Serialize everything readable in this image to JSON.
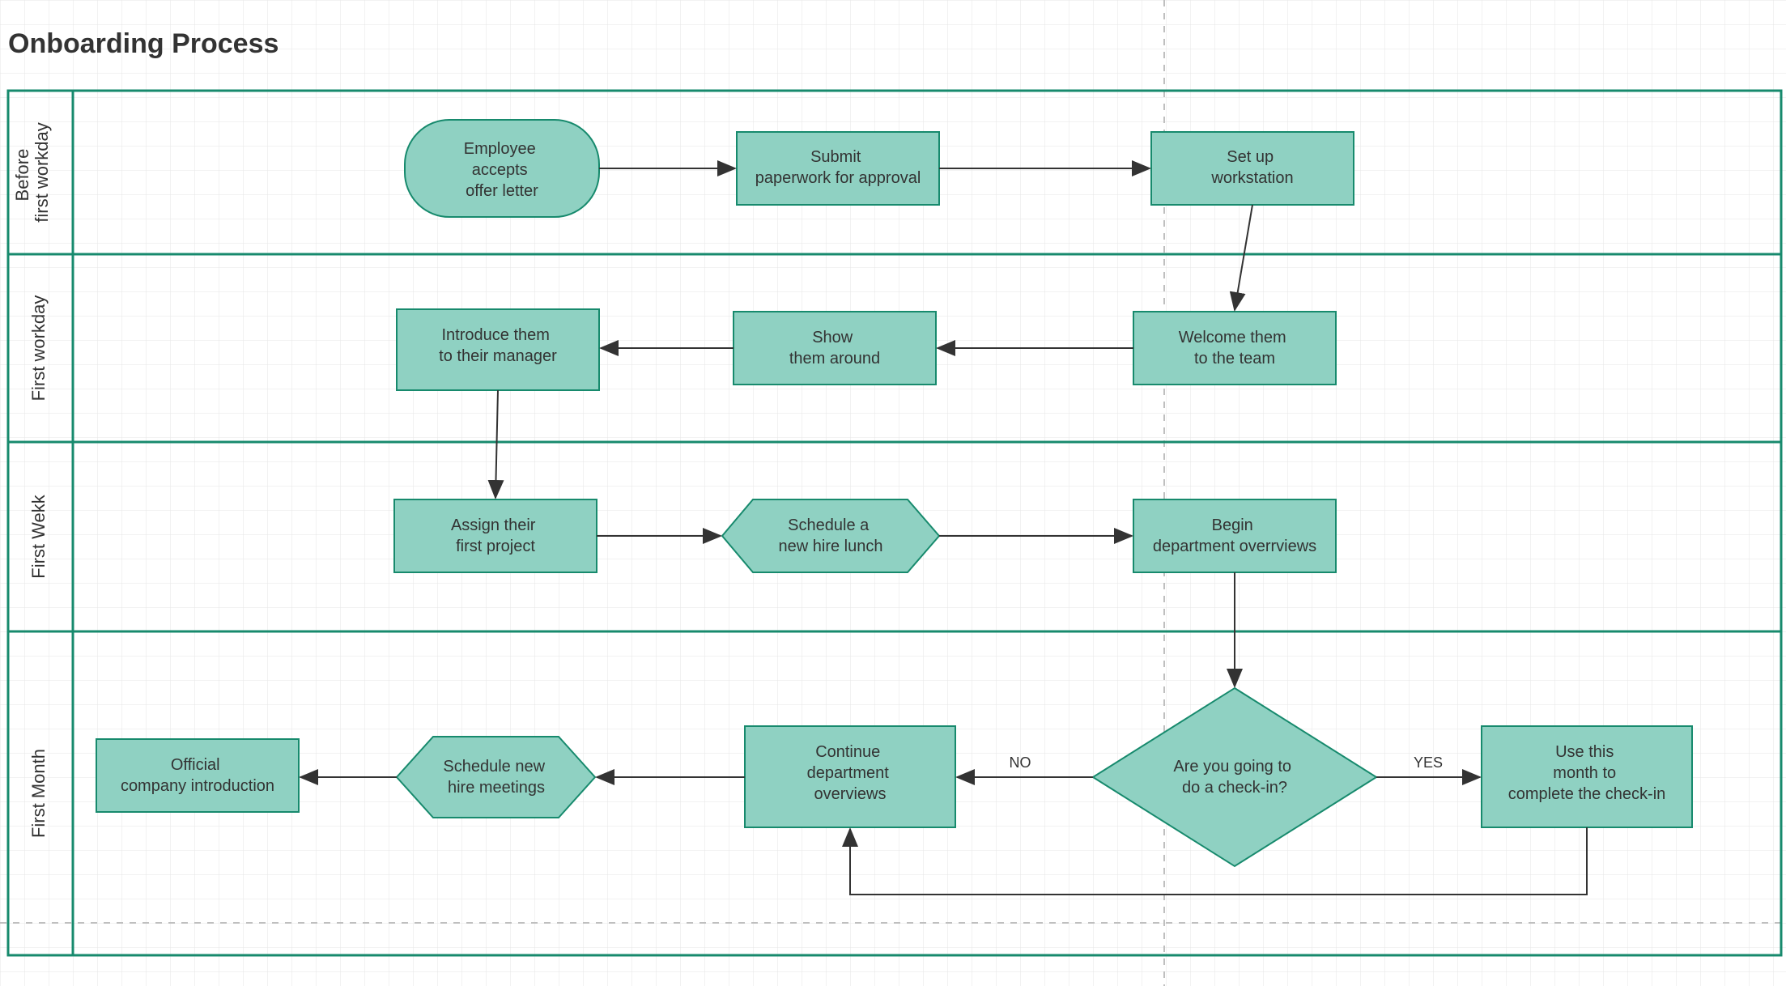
{
  "title": "Onboarding Process",
  "colors": {
    "shapeFill": "#8fd1c2",
    "shapeStroke": "#178a6d",
    "arrow": "#333333"
  },
  "lanes": [
    {
      "id": "lane0",
      "label": "Before first workday"
    },
    {
      "id": "lane1",
      "label": "First workday"
    },
    {
      "id": "lane2",
      "label": "First Wekk"
    },
    {
      "id": "lane3",
      "label": "First Month"
    }
  ],
  "nodes": {
    "n1": {
      "text": "Employee accepts offer letter",
      "shape": "terminator"
    },
    "n2": {
      "text": "Submit paperwork for approval",
      "shape": "process"
    },
    "n3": {
      "text": "Set up workstation",
      "shape": "process"
    },
    "n4": {
      "text": "Welcome them to the team",
      "shape": "process"
    },
    "n5": {
      "text": "Show them around",
      "shape": "process"
    },
    "n6": {
      "text": "Introduce them to their manager",
      "shape": "process"
    },
    "n7": {
      "text": "Assign their first project",
      "shape": "process"
    },
    "n8": {
      "text": "Schedule a new hire lunch",
      "shape": "preparation"
    },
    "n9": {
      "text": "Begin department overrviews",
      "shape": "process"
    },
    "n10": {
      "text": "Are you going to do a check-in?",
      "shape": "decision"
    },
    "n11": {
      "text": "Use this month to complete the check-in",
      "shape": "process"
    },
    "n12": {
      "text": "Continue department overviews",
      "shape": "process"
    },
    "n13": {
      "text": "Schedule new hire meetings",
      "shape": "preparation"
    },
    "n14": {
      "text": "Official company introduction",
      "shape": "process"
    }
  },
  "edgeLabels": {
    "yes": "YES",
    "no": "NO"
  }
}
